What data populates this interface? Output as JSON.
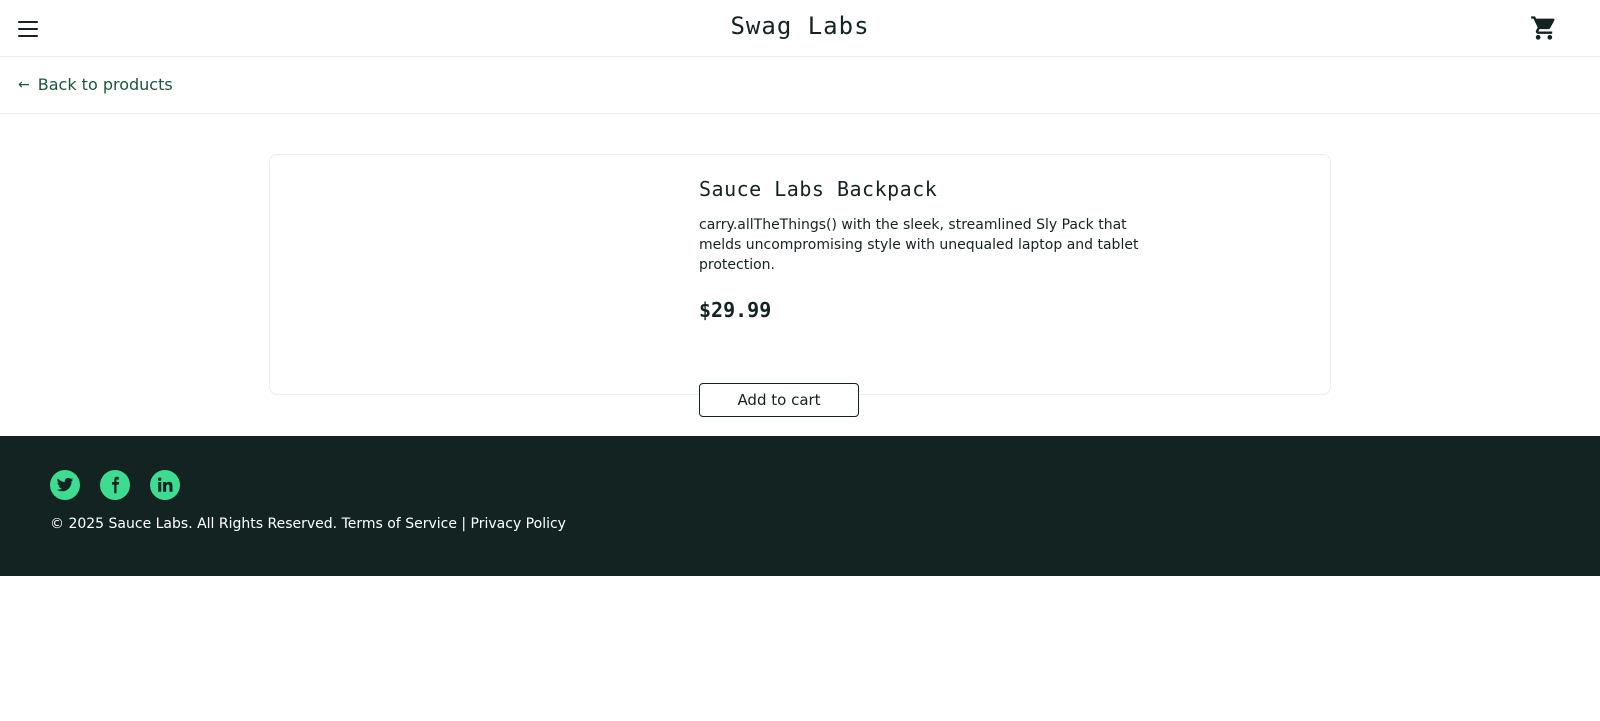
{
  "header": {
    "app_title": "Swag Labs",
    "menu_icon": "hamburger-menu-icon",
    "cart_icon": "shopping-cart-icon"
  },
  "subheader": {
    "back_label": "Back to products",
    "back_icon": "arrow-left-icon"
  },
  "product": {
    "name": "Sauce Labs Backpack",
    "description": "carry.allTheThings() with the sleek, streamlined Sly Pack that melds uncompromising style with unequaled laptop and tablet protection.",
    "price": "$29.99",
    "add_to_cart_label": "Add to cart"
  },
  "footer": {
    "social_icons": [
      "twitter-icon",
      "facebook-icon",
      "linkedin-icon"
    ],
    "copyright": "© 2025 Sauce Labs. All Rights Reserved. Terms of Service | Privacy Policy"
  },
  "colors": {
    "accent_green": "#3ddc91",
    "dark": "#132322",
    "link_green": "#18583a"
  }
}
